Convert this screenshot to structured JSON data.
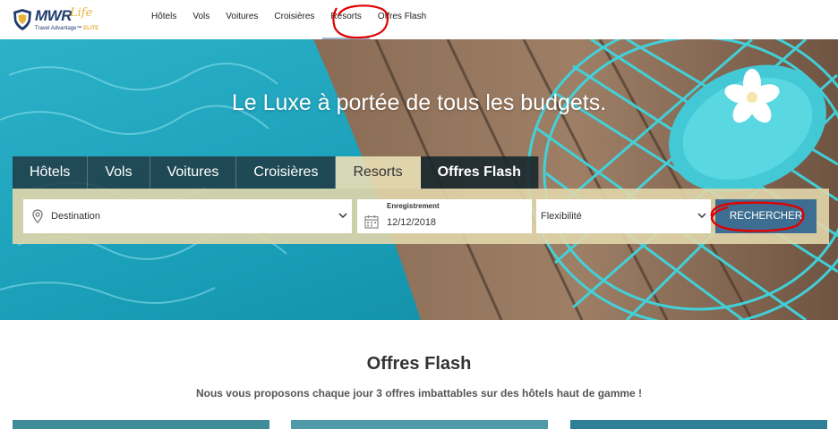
{
  "logo": {
    "brand": "MWR",
    "script": "Life",
    "tagline": "Travel Advantage™",
    "tier": "ELITE"
  },
  "nav": {
    "items": [
      {
        "label": "Hôtels"
      },
      {
        "label": "Vols"
      },
      {
        "label": "Voitures"
      },
      {
        "label": "Croisières"
      },
      {
        "label": "Resorts"
      },
      {
        "label": "Offres Flash"
      }
    ],
    "active": "Resorts"
  },
  "hero": {
    "title": "Le Luxe à portée de tous les budgets."
  },
  "tabs": [
    {
      "label": "Hôtels"
    },
    {
      "label": "Vols"
    },
    {
      "label": "Voitures"
    },
    {
      "label": "Croisières"
    },
    {
      "label": "Resorts"
    },
    {
      "label": "Offres Flash"
    }
  ],
  "search": {
    "destination_placeholder": "Destination",
    "checkin_label": "Enregistrement",
    "checkin_value": "12/12/2018",
    "flexibility": "Flexibilité",
    "button": "RECHERCHER"
  },
  "flash": {
    "title": "Offres Flash",
    "subtitle": "Nous vous proposons chaque jour 3 offres imbattables sur des hôtels haut de gamme !"
  },
  "colors": {
    "brand_navy": "#1f3c6e",
    "brand_gold": "#e7b23a",
    "search_button": "#3d6d90",
    "annotation": "#e00000"
  },
  "icons": [
    "shield-logo-icon",
    "map-pin-icon",
    "chevron-down-icon",
    "calendar-icon"
  ]
}
